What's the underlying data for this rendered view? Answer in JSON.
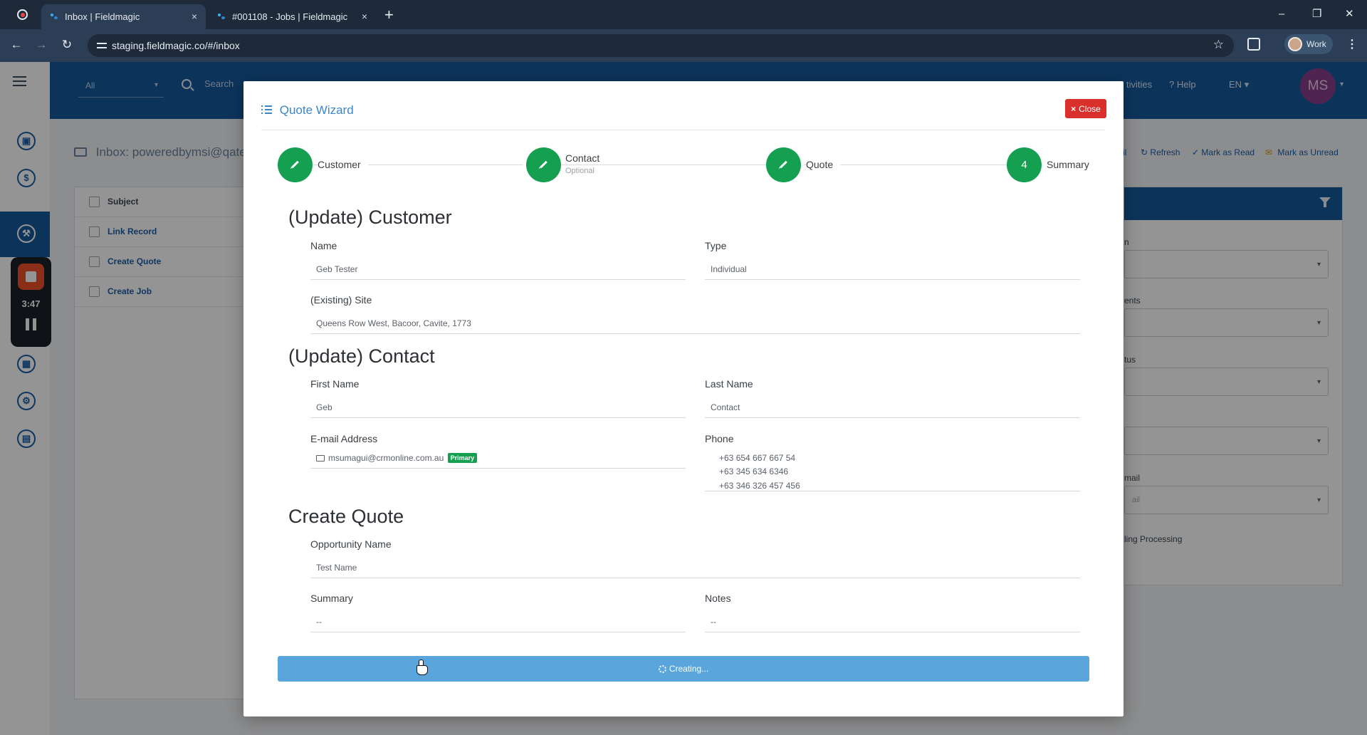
{
  "browser": {
    "tabs": [
      {
        "title": "Inbox | Fieldmagic",
        "active": true
      },
      {
        "title": "#001108 - Jobs | Fieldmagic",
        "active": false
      }
    ],
    "url": "staging.fieldmagic.co/#/inbox",
    "profile_label": "Work",
    "new_tab": "+",
    "close_tab": "×",
    "minimize": "–",
    "restore": "❐",
    "close_window": "✕",
    "back": "←",
    "forward": "→",
    "reload": "↻",
    "bookmark_star": "☆",
    "menu": "⋮"
  },
  "recorder": {
    "time": "3:47"
  },
  "topnav": {
    "filter_value": "All",
    "search_placeholder": "Search",
    "activities": "tivities",
    "help": "Help",
    "language": "EN",
    "avatar_initials": "MS",
    "help_icon": "?",
    "caret": "▾"
  },
  "sidebar": {
    "icons": [
      "contact-book-icon",
      "dollar-icon",
      "wrench-icon",
      "calendar-icon",
      "workflow-icon",
      "document-icon"
    ],
    "glyphs": [
      "▣",
      "$",
      "⚒",
      "▦",
      "⚙",
      "▤"
    ]
  },
  "inbox": {
    "title": "Inbox: poweredbymsi@qate",
    "list_header": "Subject",
    "rows": [
      "Link Record",
      "Create Quote",
      "Create Job"
    ],
    "actions": {
      "link": "il",
      "refresh": "Refresh",
      "mark_read": "Mark as Read",
      "mark_unread": "Mark as Unread"
    }
  },
  "right_panel": {
    "labels": [
      "n",
      "ents",
      "tus",
      "mail"
    ],
    "email_placeholder": "ail",
    "processing": "ling Processing"
  },
  "modal": {
    "title": "Quote Wizard",
    "close_label": "Close",
    "steps": [
      {
        "label": "Customer",
        "sub": "",
        "done": true
      },
      {
        "label": "Contact",
        "sub": "Optional",
        "done": true
      },
      {
        "label": "Quote",
        "sub": "",
        "done": true
      },
      {
        "label": "Summary",
        "sub": "",
        "number": "4",
        "done": false
      }
    ],
    "customer": {
      "heading": "(Update) Customer",
      "name_label": "Name",
      "name_value": "Geb Tester",
      "type_label": "Type",
      "type_value": "Individual",
      "site_label": "(Existing) Site",
      "site_value": "Queens Row West, Bacoor, Cavite, 1773"
    },
    "contact": {
      "heading": "(Update) Contact",
      "first_name_label": "First Name",
      "first_name_value": "Geb",
      "last_name_label": "Last Name",
      "last_name_value": "Contact",
      "email_label": "E-mail Address",
      "email_value": "msumagui@crmonline.com.au",
      "email_badge": "Primary",
      "phone_label": "Phone",
      "phones": [
        "+63 654 667 667 54",
        "+63 345 634 6346",
        "+63 346 326 457 456"
      ]
    },
    "quote": {
      "heading": "Create Quote",
      "opportunity_label": "Opportunity Name",
      "opportunity_value": "Test Name",
      "summary_label": "Summary",
      "summary_value": "--",
      "notes_label": "Notes",
      "notes_value": "--"
    },
    "submit_label": "Creating..."
  },
  "colors": {
    "primary": "#155a9e",
    "step_done": "#14a050",
    "close_button": "#d9302c",
    "submit_button": "#5aa5dc"
  }
}
